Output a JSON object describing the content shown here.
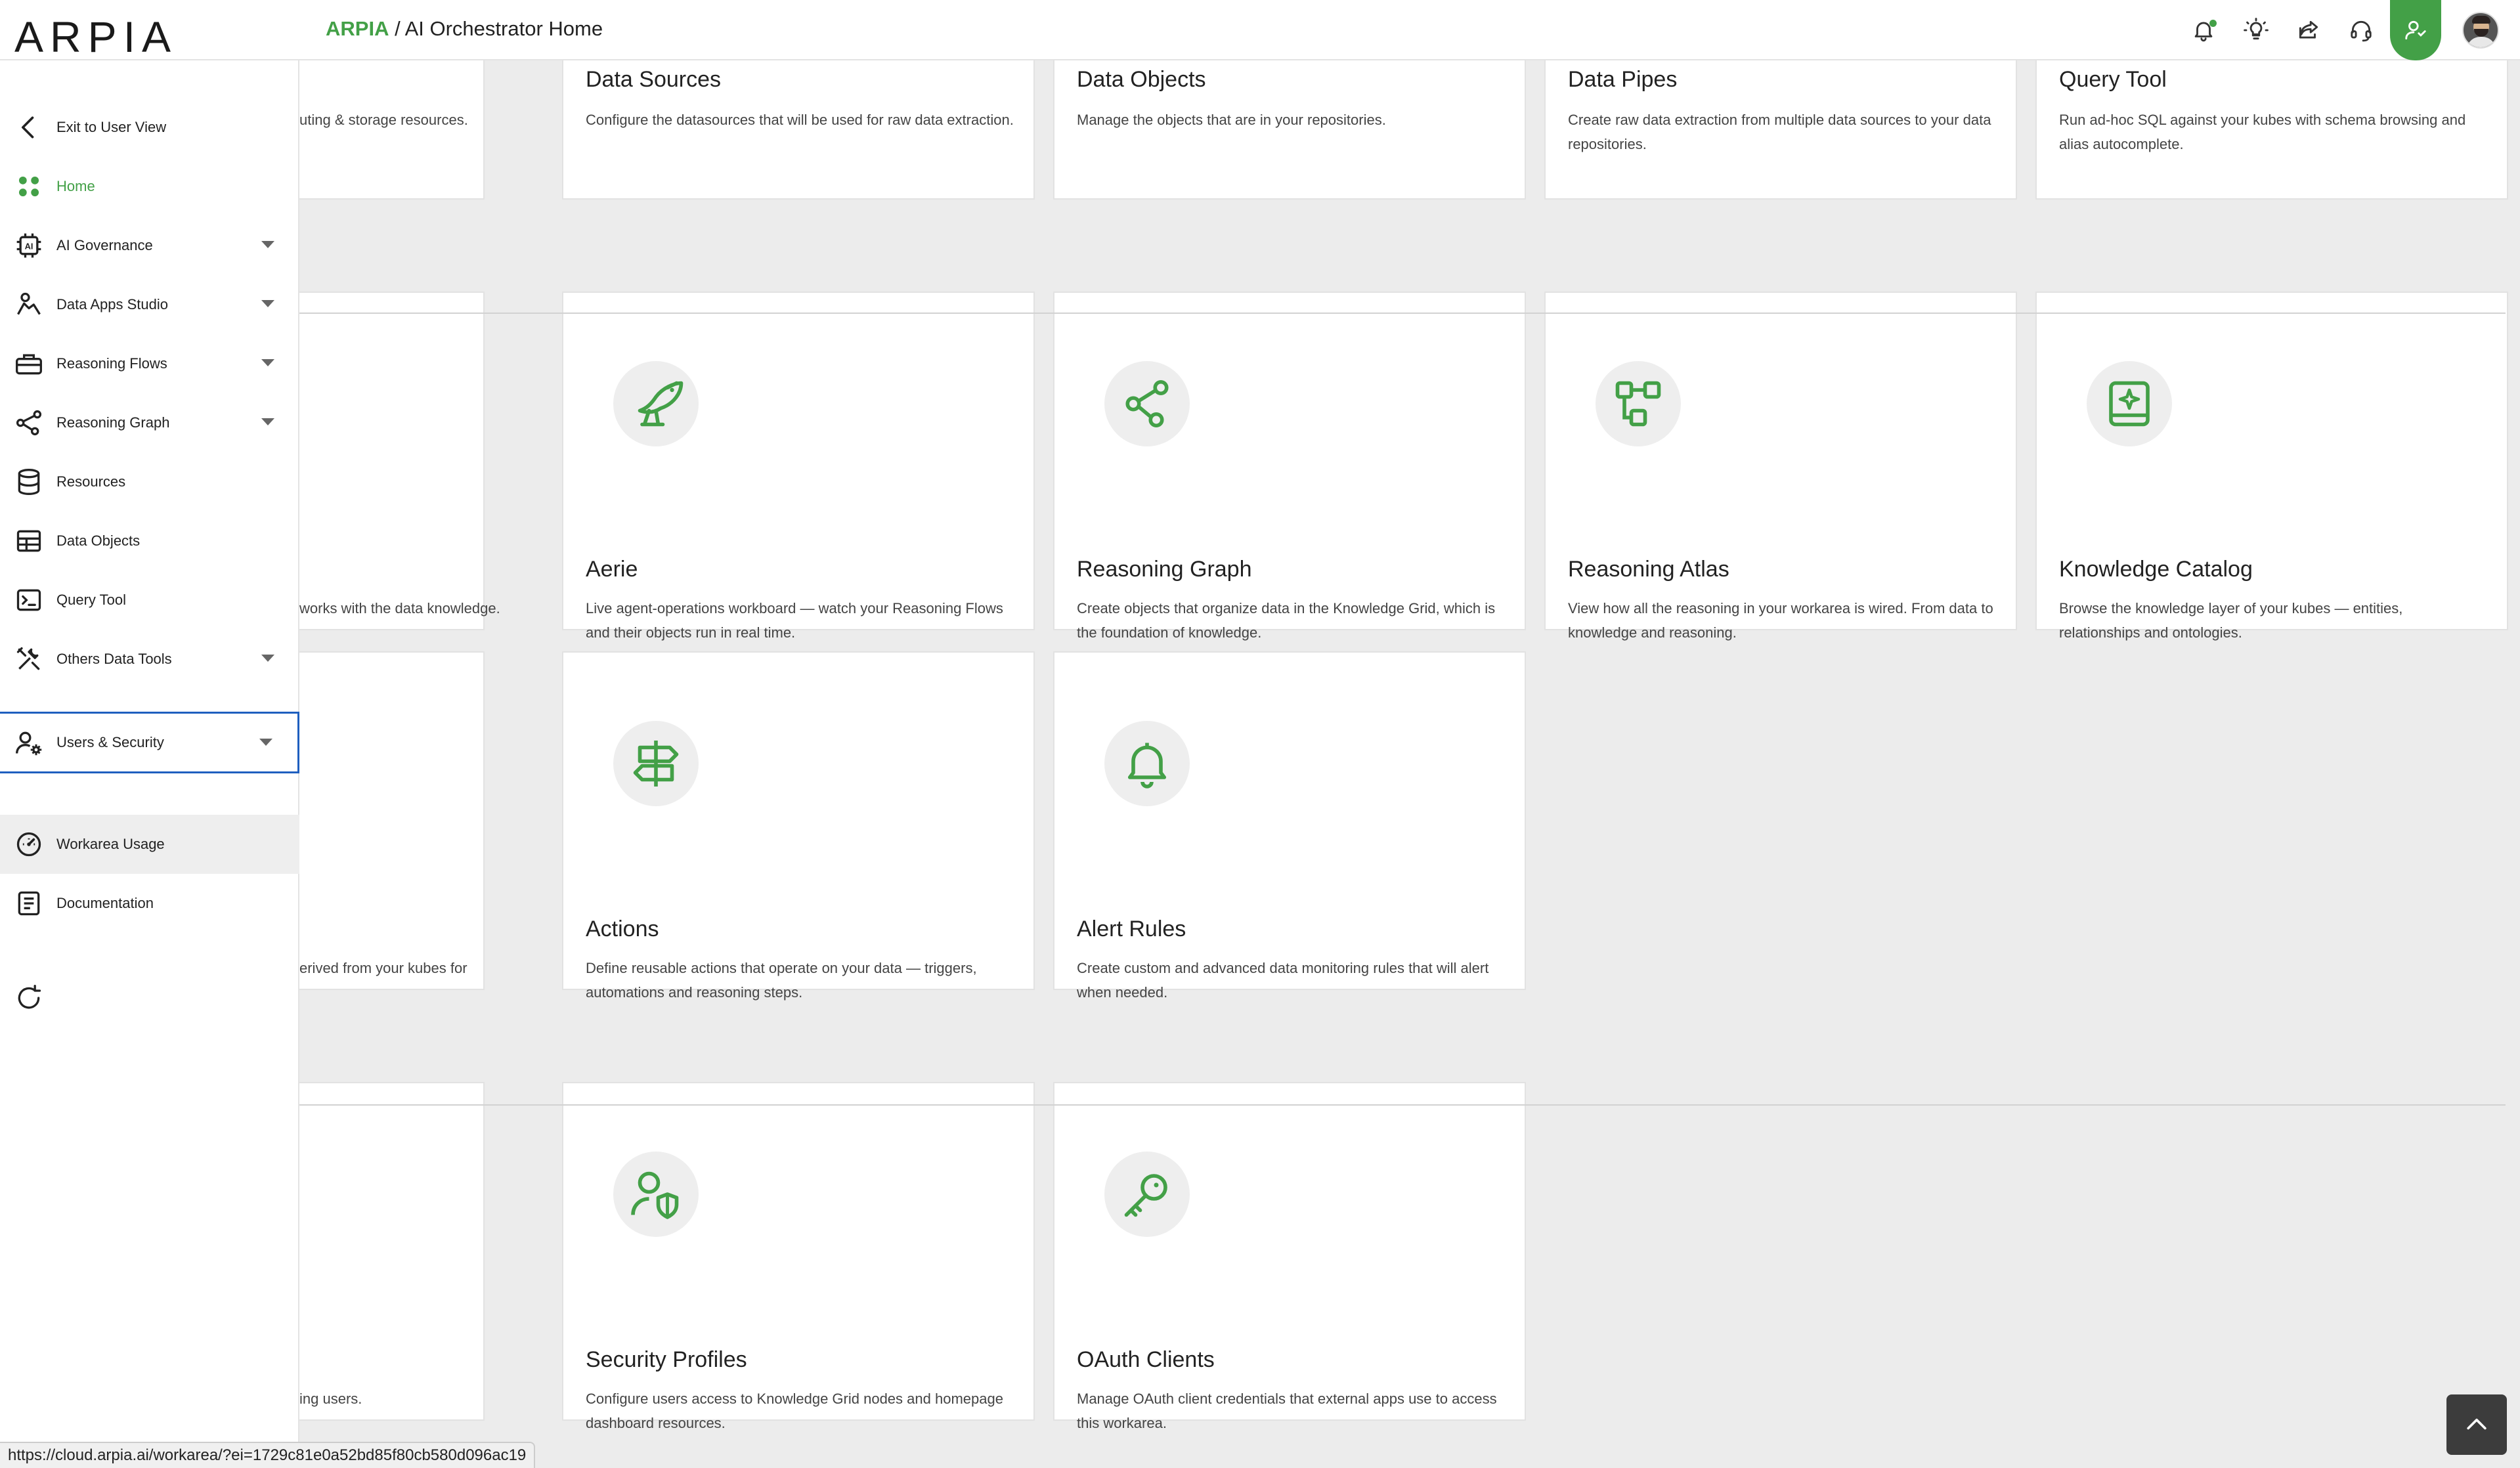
{
  "header": {
    "logo": "ARPIA",
    "breadcrumb_brand": "ARPIA",
    "breadcrumb_separator": " / ",
    "breadcrumb_page": "AI Orchestrator Home",
    "icons": [
      "bell-icon",
      "lightbulb-icon",
      "share-icon",
      "headset-icon",
      "user-admin-icon",
      "avatar"
    ]
  },
  "sidebar": {
    "items": [
      {
        "label": "Exit to User View",
        "icon": "chevron-left-icon"
      },
      {
        "label": "Home",
        "icon": "home-grid-icon"
      },
      {
        "label": "AI Governance",
        "icon": "ai-chip-icon"
      },
      {
        "label": "Data Apps Studio",
        "icon": "data-apps-icon"
      },
      {
        "label": "Reasoning Flows",
        "icon": "toolbox-icon"
      },
      {
        "label": "Reasoning Graph",
        "icon": "graph-icon"
      },
      {
        "label": "Resources",
        "icon": "database-icon"
      },
      {
        "label": "Data Objects",
        "icon": "table-icon"
      },
      {
        "label": "Query Tool",
        "icon": "terminal-icon"
      },
      {
        "label": "Others Data Tools",
        "icon": "tools-icon"
      },
      {
        "label": "Users & Security",
        "icon": "user-gear-icon"
      },
      {
        "label": "Workarea Usage",
        "icon": "gauge-icon"
      },
      {
        "label": "Documentation",
        "icon": "document-icon"
      }
    ],
    "refresh_icon": "refresh-icon"
  },
  "sections": {
    "row1": [
      {
        "title": "",
        "desc": "uting & storage resources."
      },
      {
        "title": "Data Sources",
        "desc": "Configure the datasources that will be used for raw data extraction."
      },
      {
        "title": "Data Objects",
        "desc": "Manage the objects that are in your repositories."
      },
      {
        "title": "Data Pipes",
        "desc": "Create raw data extraction from multiple data sources to your data repositories."
      },
      {
        "title": "Query Tool",
        "desc": "Run ad-hoc SQL against your kubes with schema browsing and alias autocomplete."
      }
    ],
    "row2": [
      {
        "title": "",
        "desc": " works with the data knowledge.",
        "icon": ""
      },
      {
        "title": "Aerie",
        "desc": "Live agent-operations workboard — watch your Reasoning Flows and their objects run in real time.",
        "icon": "bird-icon"
      },
      {
        "title": "Reasoning Graph",
        "desc": "Create objects that organize data in the Knowledge Grid, which is the foundation of knowledge.",
        "icon": "graph-nodes-icon"
      },
      {
        "title": "Reasoning Atlas",
        "desc": "View how all the reasoning in your workarea is wired. From data to knowledge and reasoning.",
        "icon": "flow-boxes-icon"
      },
      {
        "title": "Knowledge Catalog",
        "desc": "Browse the knowledge layer of your kubes — entities, relationships and ontologies.",
        "icon": "sparkle-book-icon"
      }
    ],
    "row3": [
      {
        "title": "",
        "desc": "erived from your kubes for",
        "icon": ""
      },
      {
        "title": "Actions",
        "desc": "Define reusable actions that operate on your data — triggers, automations and reasoning steps.",
        "icon": "signpost-icon"
      },
      {
        "title": "Alert Rules",
        "desc": "Create custom and advanced data monitoring rules that will alert when needed.",
        "icon": "bell-icon"
      }
    ],
    "row4": [
      {
        "title": "",
        "desc": "ing users.",
        "icon": ""
      },
      {
        "title": "Security Profiles",
        "desc": "Configure users access to Knowledge Grid nodes and homepage dashboard resources.",
        "icon": "user-shield-icon"
      },
      {
        "title": "OAuth Clients",
        "desc": "Manage OAuth client credentials that external apps use to access this workarea.",
        "icon": "key-icon"
      }
    ]
  },
  "status_url": "https://cloud.arpia.ai/workarea/?ei=1729c81e0a52bd85f80cb580d096ac19",
  "colors": {
    "accent": "#43a047",
    "selection": "#1f5fbf",
    "background": "#ececec"
  }
}
